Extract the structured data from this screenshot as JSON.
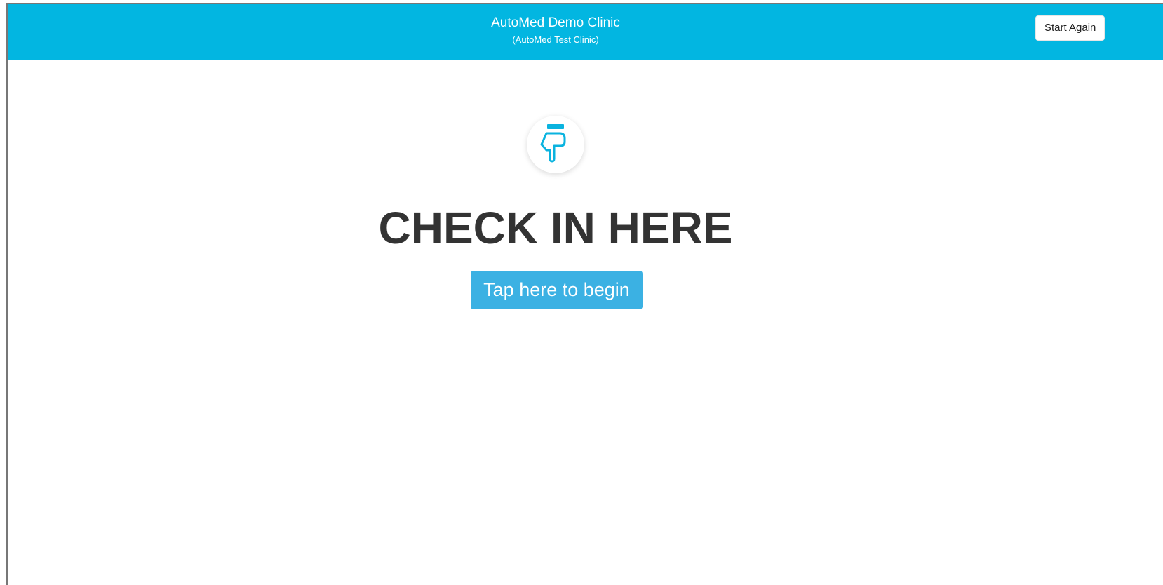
{
  "header": {
    "title": "AutoMed Demo Clinic",
    "subtitle": "(AutoMed Test Clinic)",
    "start_again_label": "Start Again",
    "background_color": "#02b6e1"
  },
  "main": {
    "icon": "hand-pointing-down-icon",
    "heading": "CHECK IN HERE",
    "begin_button_label": "Tap here to begin",
    "accent_color": "#3bb1e3"
  }
}
